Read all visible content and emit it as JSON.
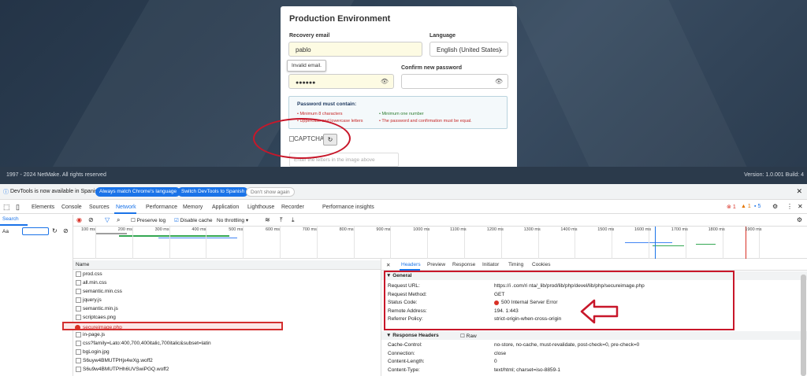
{
  "login": {
    "title": "Production Environment",
    "recovery_email_label": "Recovery email",
    "recovery_email_value": "pablo",
    "language_label": "Language",
    "language_value": "English (United States)",
    "tooltip": "Invalid email.",
    "confirm_password_label": "Confirm new password",
    "password_value": "●●●●●●",
    "password_rules_title": "Password must contain:",
    "rules": [
      {
        "text": "• Minimum 8 characters",
        "status": "fail"
      },
      {
        "text": "• Minimum one number",
        "status": "ok"
      },
      {
        "text": "• Uppercase and lowercase letters",
        "status": "fail"
      },
      {
        "text": "• The password and confirmation must be equal.",
        "status": "fail"
      }
    ],
    "captcha_alt": "CAPTCHA",
    "captcha_placeholder": "Enter the letters in the image above"
  },
  "footer": {
    "left": "1997 - 2024 NetMake. All rights reserved",
    "right": "Version: 1.0.001 Build: 4"
  },
  "devtools": {
    "notice": {
      "text": "DevTools is now available in Spanish!",
      "btn1": "Always match Chrome's language",
      "btn2": "Switch DevTools to Spanish",
      "btn3": "Don't show again"
    },
    "tabs": [
      "Elements",
      "Console",
      "Sources",
      "Network",
      "Performance",
      "Memory",
      "Application",
      "Lighthouse",
      "Recorder",
      "Performance insights"
    ],
    "status_counts": {
      "errors": "1",
      "warnings": "1",
      "info": "5"
    },
    "toolbar": {
      "preserve_log": "Preserve log",
      "disable_cache": "Disable cache",
      "throttling": "No throttling"
    },
    "search_label": "Search",
    "case_label": "Aa",
    "timeline_ticks": [
      "100 ms",
      "200 ms",
      "300 ms",
      "400 ms",
      "500 ms",
      "600 ms",
      "700 ms",
      "800 ms",
      "900 ms",
      "1000 ms",
      "1100 ms",
      "1200 ms",
      "1300 ms",
      "1400 ms",
      "1500 ms",
      "1600 ms",
      "1700 ms",
      "1800 ms",
      "1900 ms"
    ],
    "list_header": "Name",
    "requests": [
      {
        "name": "prod.css",
        "state": "normal"
      },
      {
        "name": "all.min.css",
        "state": "normal"
      },
      {
        "name": "semantic.min.css",
        "state": "normal"
      },
      {
        "name": "jquery.js",
        "state": "normal"
      },
      {
        "name": "semantic.min.js",
        "state": "normal"
      },
      {
        "name": "scriptcaes.png",
        "state": "normal"
      },
      {
        "name": "secureimage.php",
        "state": "error"
      },
      {
        "name": "in-page.js",
        "state": "normal"
      },
      {
        "name": "css?family=Lato:400,700,400italic,700italic&subset=latin",
        "state": "normal"
      },
      {
        "name": "bgLogin.jpg",
        "state": "normal"
      },
      {
        "name": "S6uyw4BMUTPHjx4wXg.woff2",
        "state": "normal"
      },
      {
        "name": "S6u9w4BMUTPHh6UVSwiPGQ.woff2",
        "state": "normal"
      }
    ],
    "detail_tabs": [
      "Headers",
      "Preview",
      "Response",
      "Initiator",
      "Timing",
      "Cookies"
    ],
    "general_title": "▼ General",
    "general": [
      {
        "key": "Request URL:",
        "value": "https://i               .com/ri          nta/_lib/prod/lib/php/devel/lib/php/secureimage.php"
      },
      {
        "key": "Request Method:",
        "value": "GET"
      },
      {
        "key": "Status Code:",
        "value": "500 Internal Server Error"
      },
      {
        "key": "Remote Address:",
        "value": "194.          1:443"
      },
      {
        "key": "Referrer Policy:",
        "value": "strict-origin-when-cross-origin"
      }
    ],
    "response_title": "▼ Response Headers",
    "raw_label": "Raw",
    "response": [
      {
        "key": "Cache-Control:",
        "value": "no-store, no-cache, must-revalidate, post-check=0, pre-check=0"
      },
      {
        "key": "Connection:",
        "value": "close"
      },
      {
        "key": "Content-Length:",
        "value": "0"
      },
      {
        "key": "Content-Type:",
        "value": "text/html; charset=iso-8859-1"
      }
    ]
  }
}
